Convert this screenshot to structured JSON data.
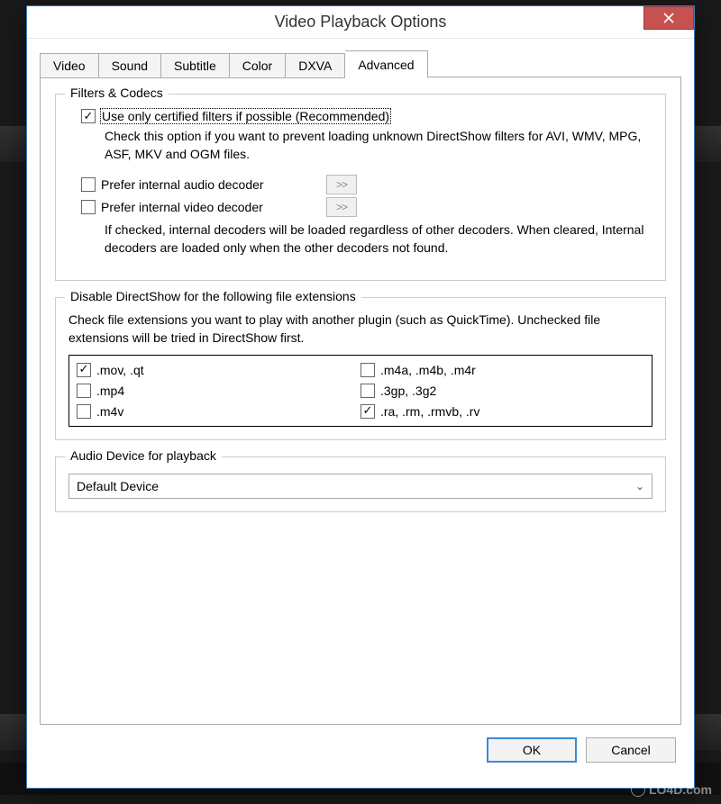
{
  "window": {
    "title": "Video Playback Options"
  },
  "tabs": {
    "items": [
      "Video",
      "Sound",
      "Subtitle",
      "Color",
      "DXVA",
      "Advanced"
    ],
    "active_index": 5
  },
  "filters_codecs": {
    "legend": "Filters & Codecs",
    "certified": {
      "checked": true,
      "label": "Use only certified filters if possible (Recommended)",
      "desc": "Check this option if you want to prevent loading unknown DirectShow filters for AVI, WMV, MPG, ASF, MKV and OGM files."
    },
    "audio_decoder": {
      "checked": false,
      "label": "Prefer internal audio decoder",
      "more": ">>"
    },
    "video_decoder": {
      "checked": false,
      "label": "Prefer internal video decoder",
      "more": ">>"
    },
    "decoder_desc": "If checked, internal decoders will be loaded regardless of other decoders. When cleared, Internal decoders are loaded only when the other decoders not found."
  },
  "disable_directshow": {
    "legend": "Disable DirectShow for the following file extensions",
    "desc": "Check file extensions you want to play with another plugin (such as QuickTime). Unchecked file extensions will be tried in DirectShow first.",
    "items": [
      {
        "label": ".mov, .qt",
        "checked": true
      },
      {
        "label": ".m4a, .m4b, .m4r",
        "checked": false
      },
      {
        "label": ".mp4",
        "checked": false
      },
      {
        "label": ".3gp, .3g2",
        "checked": false
      },
      {
        "label": ".m4v",
        "checked": false
      },
      {
        "label": ".ra, .rm, .rmvb, .rv",
        "checked": true
      }
    ]
  },
  "audio_device": {
    "legend": "Audio Device for playback",
    "selected": "Default Device"
  },
  "buttons": {
    "ok": "OK",
    "cancel": "Cancel"
  },
  "watermark": "LO4D.com"
}
